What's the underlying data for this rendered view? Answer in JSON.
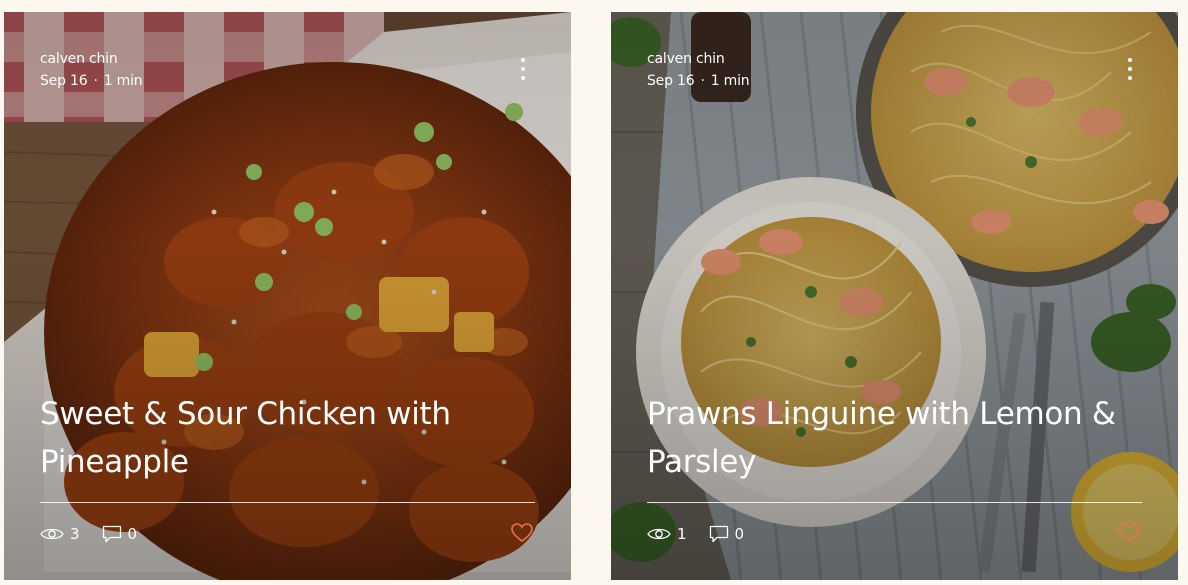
{
  "posts": [
    {
      "author": "calven chin",
      "date": "Sep 16",
      "read_time": "1 min",
      "title": "Sweet & Sour Chicken with Pineapple",
      "views": "3",
      "comments": "0"
    },
    {
      "author": "calven chin",
      "date": "Sep 16",
      "read_time": "1 min",
      "title": "Prawns Linguine with Lemon & Parsley",
      "views": "1",
      "comments": "0"
    }
  ],
  "icons": {
    "views": "eye-icon",
    "comments": "comment-icon",
    "like": "heart-icon",
    "menu": "more-vertical-icon"
  },
  "colors": {
    "page_background": "#fdf8ef",
    "like_heart": "#e8734f",
    "text": "#ffffff"
  }
}
